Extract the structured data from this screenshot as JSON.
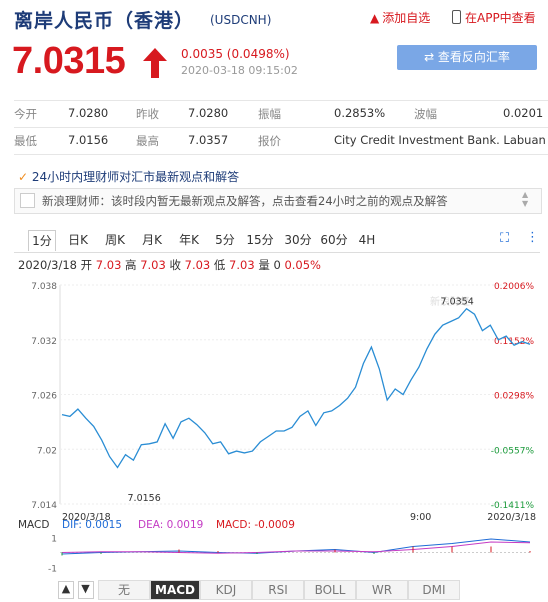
{
  "header": {
    "title": "离岸人民币（香港）",
    "code": "(USDCNH)",
    "add_fav": "添加自选",
    "in_app": "在APP中查看"
  },
  "quote": {
    "price": "7.0315",
    "change": "0.0035 (0.0498%)",
    "time": "2020-03-18 09:15:02",
    "reverse_btn": "⇄ 查看反向汇率",
    "up_color": "#d7191f"
  },
  "stats": [
    [
      {
        "label": "今开",
        "value": "7.0280"
      },
      {
        "label": "昨收",
        "value": "7.0280"
      },
      {
        "label": "振幅",
        "value": "0.2853%"
      },
      {
        "label": "波幅",
        "value": "0.0201"
      }
    ],
    [
      {
        "label": "最低",
        "value": "7.0156"
      },
      {
        "label": "最高",
        "value": "7.0357"
      },
      {
        "label": "报价",
        "value": "City Credit Investment Bank. Labuan"
      }
    ]
  ],
  "news": {
    "heading": "24小时内理财师对汇市最新观点和解答",
    "text": "新浪理财师：该时段内暂无最新观点及解答，点击查看24小时之前的观点及解答"
  },
  "tabs": [
    "1分",
    "日K",
    "周K",
    "月K",
    "年K",
    "5分",
    "15分",
    "30分",
    "60分",
    "4H"
  ],
  "ohlc": {
    "date": "2020/3/18",
    "open_label": "开",
    "open": "7.03",
    "high_label": "高",
    "high": "7.03",
    "close_label": "收",
    "close": "7.03",
    "low_label": "低",
    "low": "7.03",
    "vol_label": "量",
    "vol": "0",
    "pct": "0.05%"
  },
  "chart_data": {
    "type": "line",
    "y_ticks": [
      "7.038",
      "7.032",
      "7.026",
      "7.02",
      "7.014"
    ],
    "pct_ticks": [
      "0.2006%",
      "0.1152%",
      "0.0298%",
      "-0.0557%",
      "-0.1411%"
    ],
    "x_ticks": [
      "2020/3/18",
      "9:00",
      "2020/3/18"
    ],
    "ylim": [
      7.014,
      7.038
    ],
    "max_label": "7.0354",
    "min_label": "7.0156",
    "watermark": "新浪财经",
    "values": [
      7.0238,
      7.0236,
      7.0244,
      7.0234,
      7.0225,
      7.021,
      7.0192,
      7.018,
      7.0194,
      7.0188,
      7.0205,
      7.0206,
      7.0208,
      7.0228,
      7.0212,
      7.023,
      7.0234,
      7.0227,
      7.0218,
      7.0206,
      7.0208,
      7.0195,
      7.0198,
      7.0196,
      7.0198,
      7.0208,
      7.0214,
      7.022,
      7.022,
      7.0224,
      7.0236,
      7.0242,
      7.0226,
      7.024,
      7.0242,
      7.0248,
      7.0256,
      7.0268,
      7.0294,
      7.0312,
      7.0288,
      7.0254,
      7.0266,
      7.026,
      7.0276,
      7.029,
      7.031,
      7.0326,
      7.0336,
      7.034,
      7.0344,
      7.0354,
      7.0348,
      7.033,
      7.0336,
      7.032,
      7.0324,
      7.0314,
      7.0318,
      7.0315
    ]
  },
  "macd": {
    "label": "MACD",
    "dif_label": "DIF:",
    "dif": "0.0015",
    "dea_label": "DEA:",
    "dea": "0.0019",
    "macd_label": "MACD:",
    "macd": "-0.0009",
    "y_ticks": [
      "1",
      "-1"
    ],
    "dif_values": [
      -0.1,
      0.0,
      0.05,
      0.1,
      0.0,
      -0.05,
      0.1,
      0.2,
      0.0,
      0.4,
      0.6,
      0.9,
      0.7
    ],
    "dea_values": [
      0.0,
      0.05,
      0.05,
      0.0,
      -0.05,
      0.0,
      0.1,
      0.1,
      0.05,
      0.2,
      0.4,
      0.7,
      0.65
    ],
    "dif_color": "#1e6bd6",
    "dea_color": "#c43cc4",
    "macd_color": "#d7191f"
  },
  "bottom_tabs": [
    "无",
    "MACD",
    "KDJ",
    "RSI",
    "BOLL",
    "WR",
    "DMI"
  ]
}
